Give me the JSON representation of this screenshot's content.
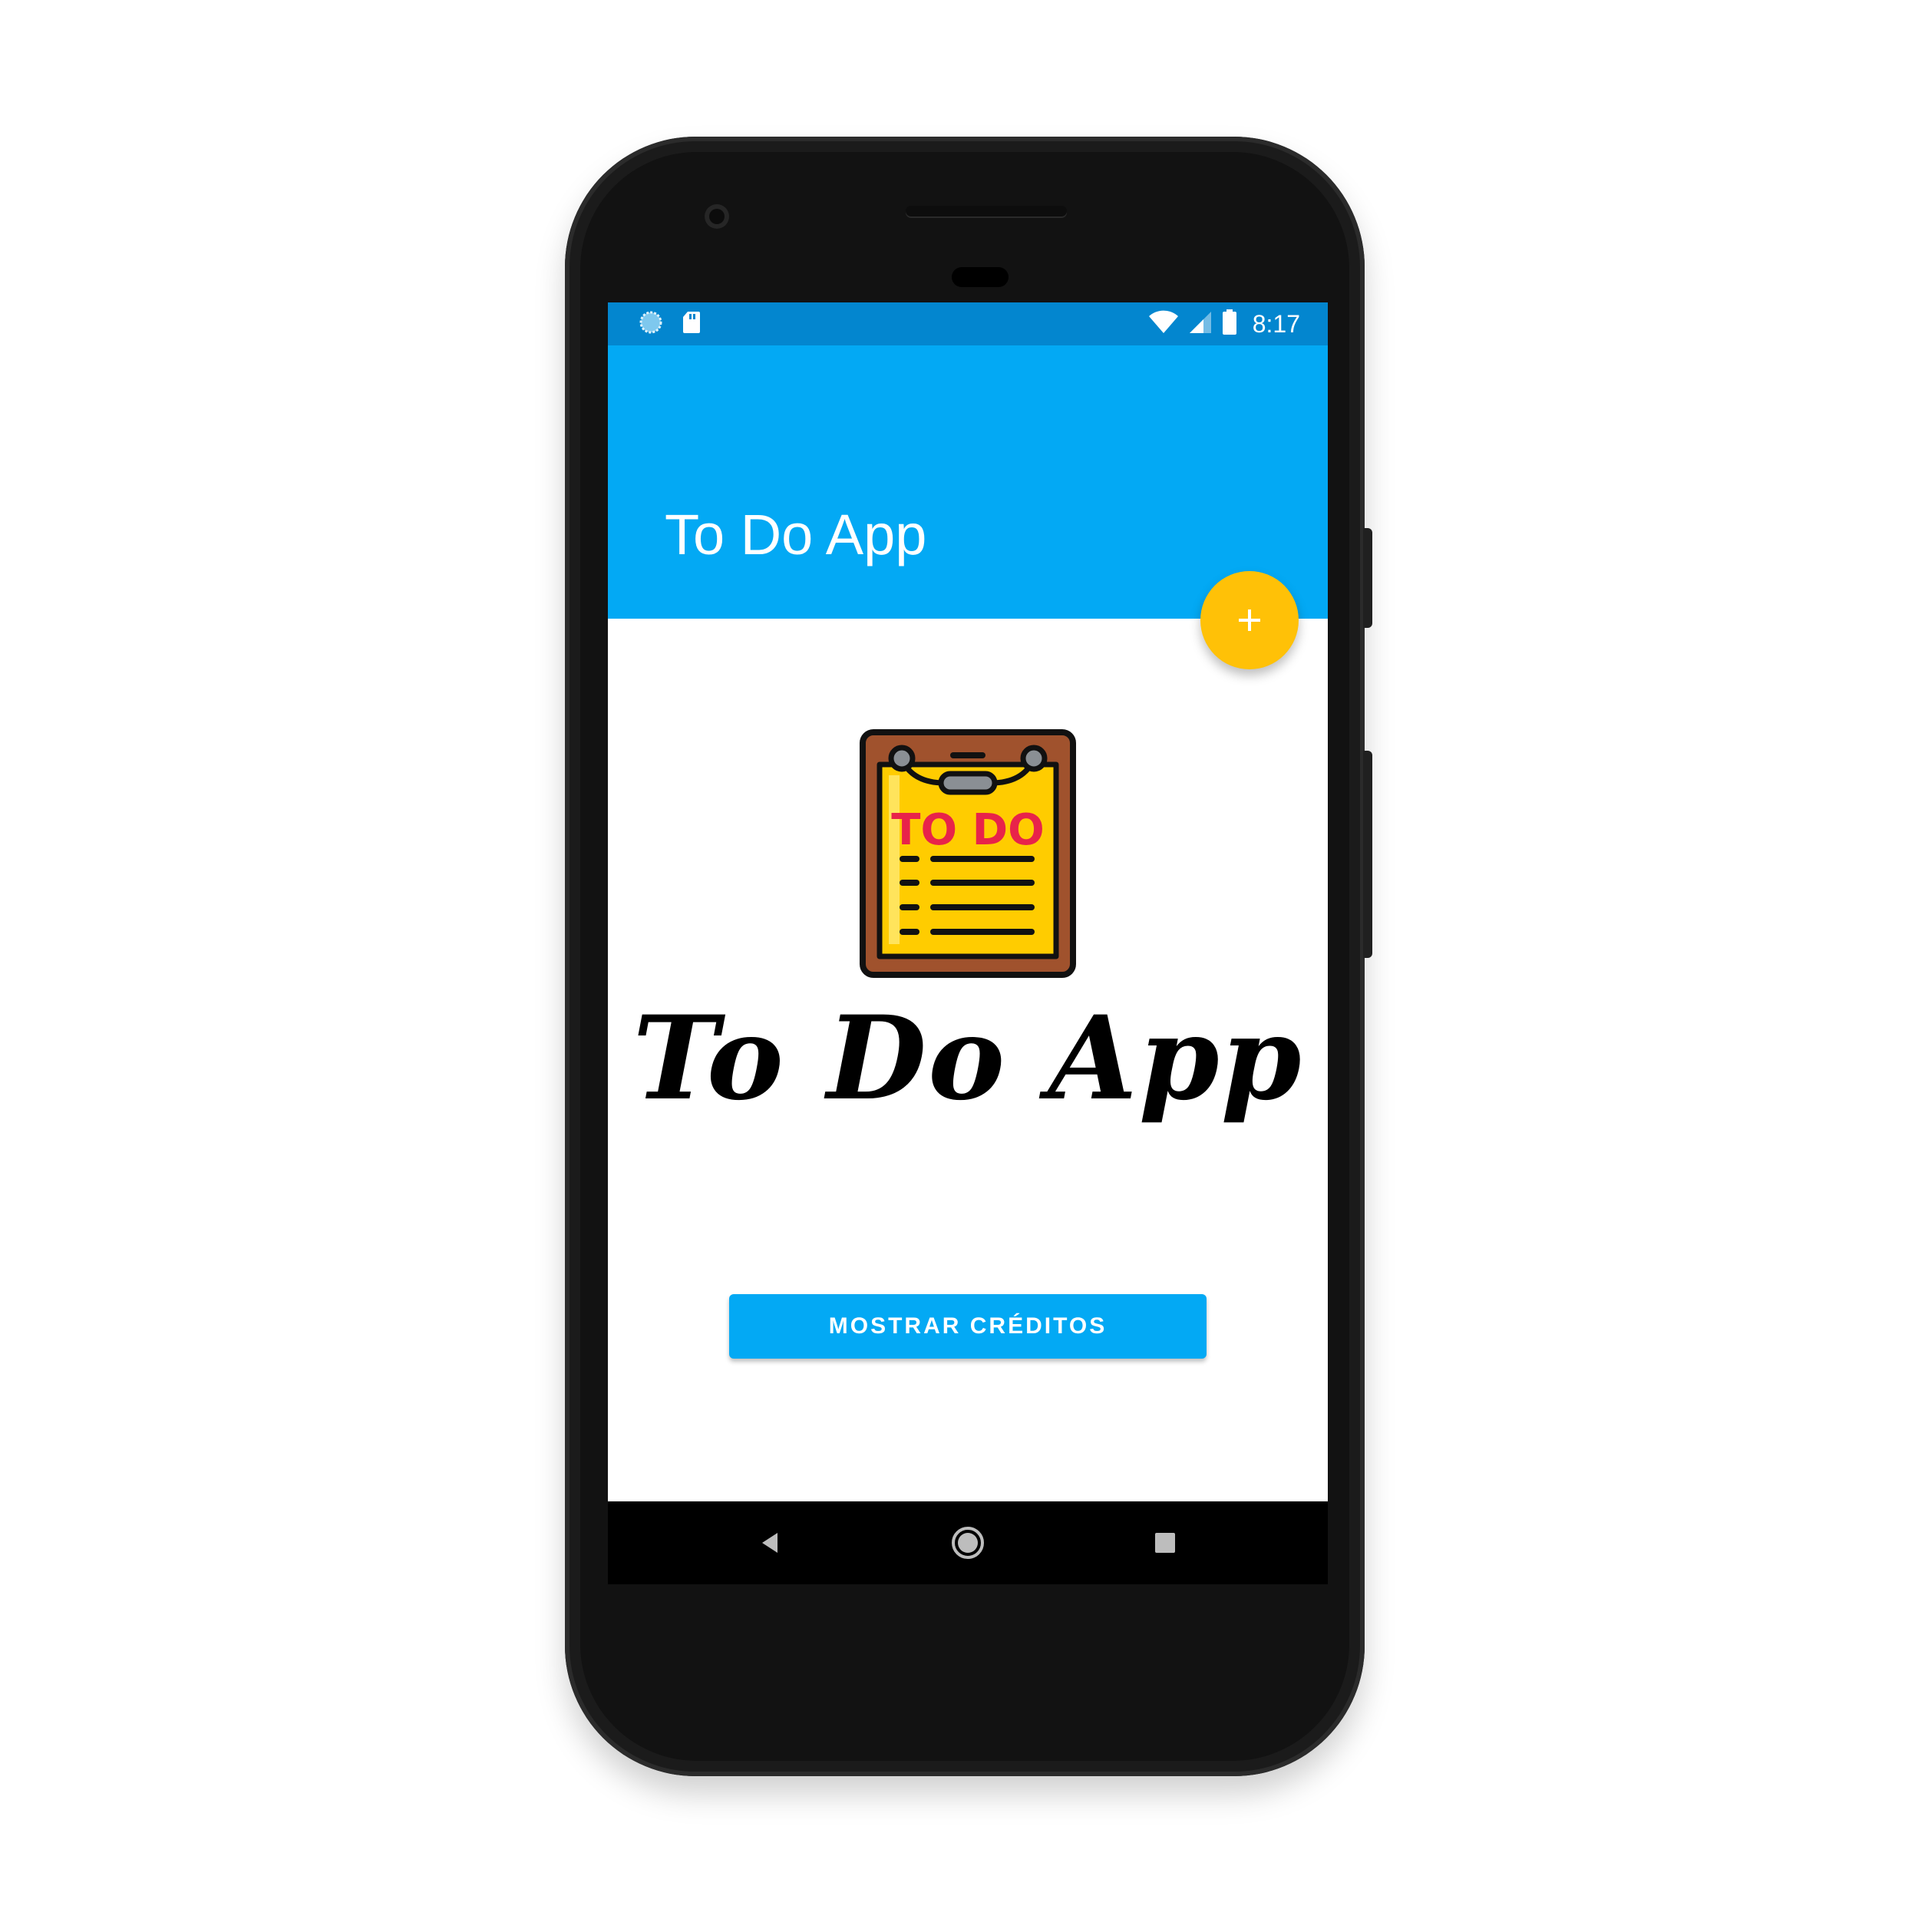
{
  "status_bar": {
    "time": "8:17",
    "left_icons": [
      "sync-icon",
      "sd-card-icon"
    ],
    "right_icons": [
      "wifi-icon",
      "cell-signal-icon",
      "battery-icon"
    ],
    "background": "#0386cf"
  },
  "app_bar": {
    "title": "To Do App",
    "background": "#03a9f4"
  },
  "fab": {
    "label": "+",
    "color": "#ffc107",
    "icon": "add-icon"
  },
  "logo": {
    "icon": "clipboard-todo-icon",
    "badge_text": "TO DO",
    "heading": "To Do App"
  },
  "credits_button": {
    "label": "MOSTRAR CRÉDITOS",
    "color": "#03a9f4"
  },
  "nav_bar": {
    "buttons": [
      "back-icon",
      "home-icon",
      "recents-icon"
    ]
  }
}
